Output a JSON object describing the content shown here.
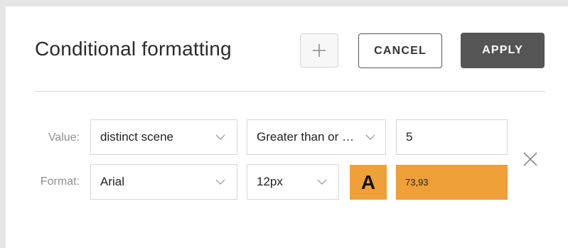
{
  "dialog": {
    "title": "Conditional formatting",
    "add_icon": "plus-icon",
    "cancel_label": "CANCEL",
    "apply_label": "APPLY"
  },
  "rule": {
    "value_label": "Value:",
    "format_label": "Format:",
    "column": "distinct scene",
    "operator": "Greater than or …",
    "threshold": "5",
    "font_family": "Arial",
    "font_size": "12px",
    "text_color_glyph": "A",
    "background_value": "73,93",
    "remove_icon": "close-icon"
  },
  "colors": {
    "accent_orange": "#f0a038",
    "apply_bg": "#555555"
  }
}
